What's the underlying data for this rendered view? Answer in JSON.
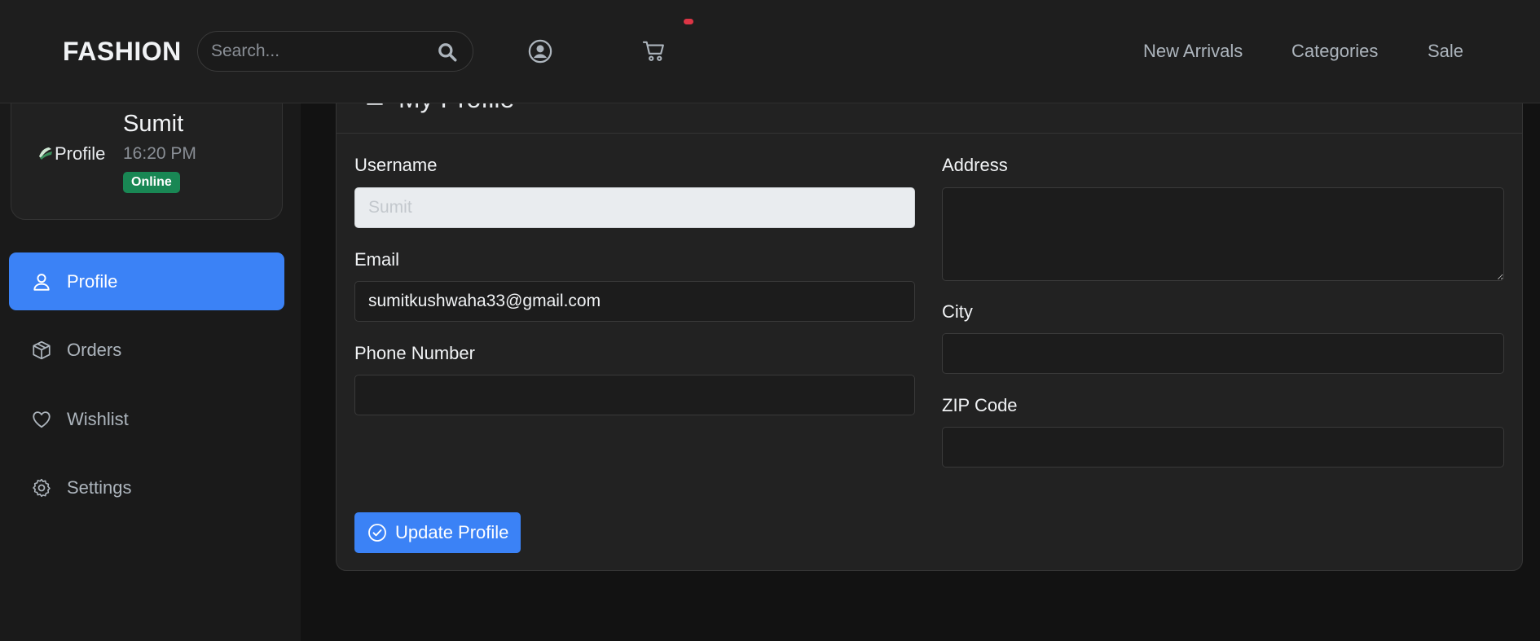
{
  "header": {
    "brand": "FASHION",
    "search_placeholder": "Search...",
    "links": [
      "New Arrivals",
      "Categories",
      "Sale"
    ],
    "icons": {
      "search": "search-icon",
      "account": "user-circle-icon",
      "cart": "cart-icon"
    },
    "accent_color": "#3b82f6",
    "cart_dot_color": "#dc3545"
  },
  "user": {
    "avatar_alt": "Profile",
    "name": "Sumit",
    "time": "16:20 PM",
    "status": "Online",
    "status_color": "#198754"
  },
  "sidebar": {
    "items": [
      {
        "label": "Profile",
        "icon": "user-icon",
        "active": true
      },
      {
        "label": "Orders",
        "icon": "box-icon",
        "active": false
      },
      {
        "label": "Wishlist",
        "icon": "heart-icon",
        "active": false
      },
      {
        "label": "Settings",
        "icon": "gear-icon",
        "active": false
      }
    ]
  },
  "profile_form": {
    "title": "My Profile",
    "username_label": "Username",
    "username_value": "Sumit",
    "email_label": "Email",
    "email_value": "sumitkushwaha33@gmail.com",
    "phone_label": "Phone Number",
    "phone_value": "",
    "address_label": "Address",
    "address_value": "",
    "city_label": "City",
    "city_value": "",
    "zip_label": "ZIP Code",
    "zip_value": "",
    "submit_label": "Update Profile"
  }
}
